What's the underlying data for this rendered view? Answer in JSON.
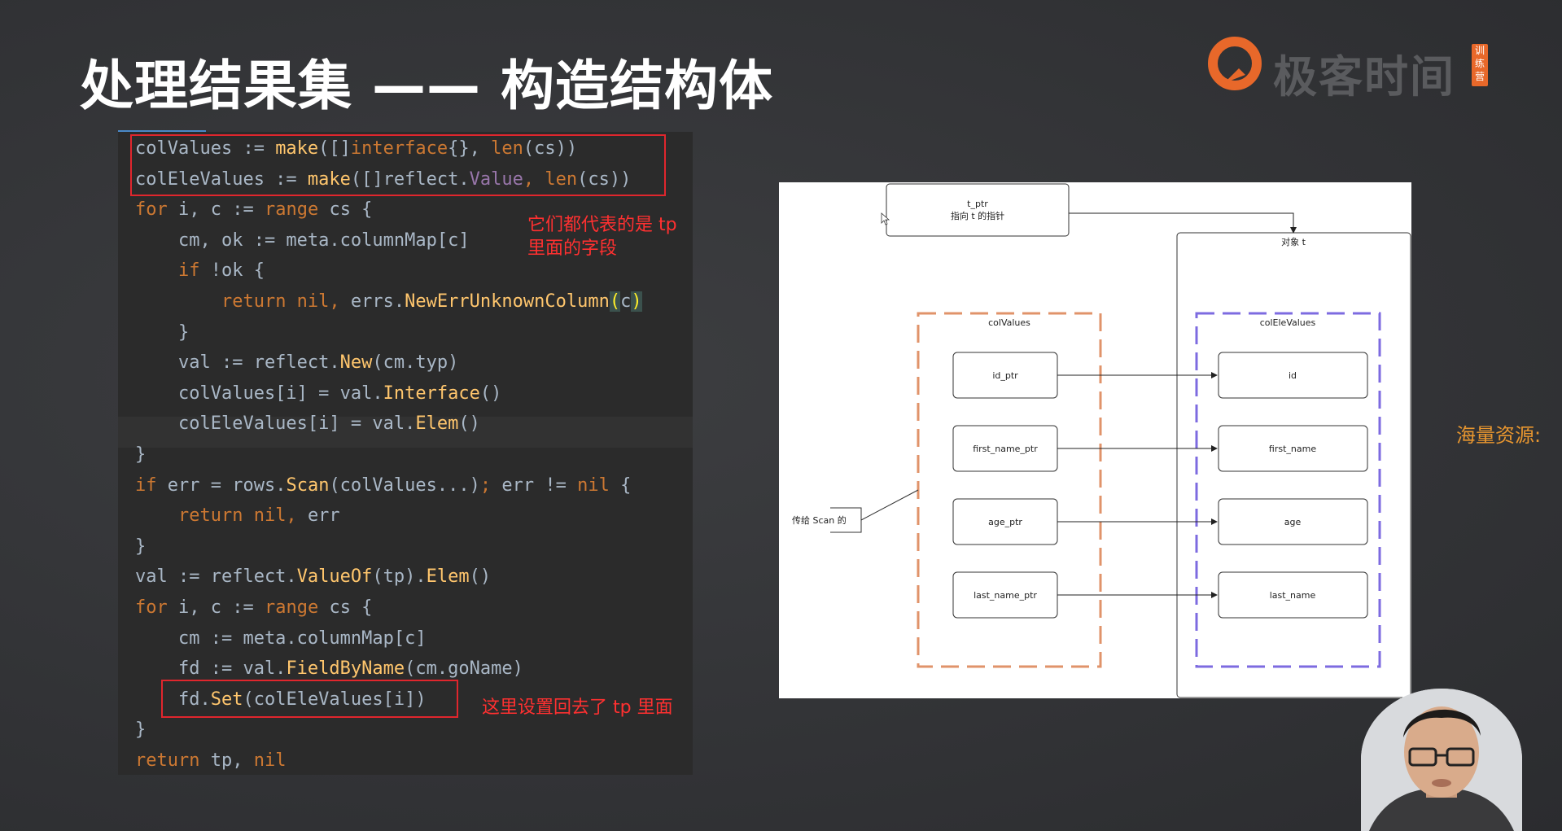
{
  "slide": {
    "title": "处理结果集 —— 构造结构体"
  },
  "logo": {
    "text": "极客时间",
    "badge": "训练营"
  },
  "code": {
    "lines": [
      [
        {
          "t": "colValues := ",
          "c": "pl"
        },
        {
          "t": "make",
          "c": "fn"
        },
        {
          "t": "([]",
          "c": "pl"
        },
        {
          "t": "interface",
          "c": "kw"
        },
        {
          "t": "{}, ",
          "c": "pl"
        },
        {
          "t": "len",
          "c": "kw"
        },
        {
          "t": "(cs))",
          "c": "pl"
        }
      ],
      [
        {
          "t": "colEleValues := ",
          "c": "pl"
        },
        {
          "t": "make",
          "c": "fn"
        },
        {
          "t": "([]reflect.",
          "c": "pl"
        },
        {
          "t": "Value",
          "c": "vl"
        },
        {
          "t": ", ",
          "c": "kw"
        },
        {
          "t": "len",
          "c": "kw"
        },
        {
          "t": "(cs))",
          "c": "pl"
        }
      ],
      [
        {
          "t": "for",
          "c": "kw"
        },
        {
          "t": " i, c := ",
          "c": "pl"
        },
        {
          "t": "range",
          "c": "kw"
        },
        {
          "t": " cs {",
          "c": "pl"
        }
      ],
      [
        {
          "t": "    cm, ok := meta.columnMap[c]",
          "c": "pl"
        }
      ],
      [
        {
          "t": "    ",
          "c": "pl"
        },
        {
          "t": "if",
          "c": "kw"
        },
        {
          "t": " !ok {",
          "c": "pl"
        }
      ],
      [
        {
          "t": "        ",
          "c": "pl"
        },
        {
          "t": "return nil, ",
          "c": "kw"
        },
        {
          "t": "errs.",
          "c": "pl"
        },
        {
          "t": "NewErrUnknownColumn",
          "c": "fn"
        },
        {
          "t": "(",
          "c": "br"
        },
        {
          "t": "c",
          "c": "pl"
        },
        {
          "t": ")",
          "c": "br"
        }
      ],
      [
        {
          "t": "    }",
          "c": "pl"
        }
      ],
      [
        {
          "t": "    val := reflect.",
          "c": "pl"
        },
        {
          "t": "New",
          "c": "fn"
        },
        {
          "t": "(cm.typ)",
          "c": "pl"
        }
      ],
      [
        {
          "t": "    colValues[i] = val.",
          "c": "pl"
        },
        {
          "t": "Interface",
          "c": "fn"
        },
        {
          "t": "()",
          "c": "pl"
        }
      ],
      [
        {
          "t": "    colEleValues[i] = val.",
          "c": "pl"
        },
        {
          "t": "Elem",
          "c": "fn"
        },
        {
          "t": "()",
          "c": "pl"
        }
      ],
      [
        {
          "t": "}",
          "c": "pl"
        }
      ],
      [
        {
          "t": "if",
          "c": "kw"
        },
        {
          "t": " err = rows.",
          "c": "pl"
        },
        {
          "t": "Scan",
          "c": "fn"
        },
        {
          "t": "(colValues...)",
          "c": "pl"
        },
        {
          "t": ";",
          "c": "kw"
        },
        {
          "t": " err != ",
          "c": "pl"
        },
        {
          "t": "nil",
          "c": "kw"
        },
        {
          "t": " {",
          "c": "pl"
        }
      ],
      [
        {
          "t": "    ",
          "c": "pl"
        },
        {
          "t": "return nil, ",
          "c": "kw"
        },
        {
          "t": "err",
          "c": "pl"
        }
      ],
      [
        {
          "t": "}",
          "c": "pl"
        }
      ],
      [
        {
          "t": "val := reflect.",
          "c": "pl"
        },
        {
          "t": "ValueOf",
          "c": "fn"
        },
        {
          "t": "(tp).",
          "c": "pl"
        },
        {
          "t": "Elem",
          "c": "fn"
        },
        {
          "t": "()",
          "c": "pl"
        }
      ],
      [
        {
          "t": "for",
          "c": "kw"
        },
        {
          "t": " i, c := ",
          "c": "pl"
        },
        {
          "t": "range",
          "c": "kw"
        },
        {
          "t": " cs {",
          "c": "pl"
        }
      ],
      [
        {
          "t": "    cm := meta.columnMap[c]",
          "c": "pl"
        }
      ],
      [
        {
          "t": "    fd := val.",
          "c": "pl"
        },
        {
          "t": "FieldByName",
          "c": "fn"
        },
        {
          "t": "(cm.goName)",
          "c": "pl"
        }
      ],
      [
        {
          "t": "    fd.",
          "c": "pl"
        },
        {
          "t": "Set",
          "c": "fn"
        },
        {
          "t": "(colEleValues[i])",
          "c": "pl"
        }
      ],
      [
        {
          "t": "}",
          "c": "pl"
        }
      ],
      [
        {
          "t": "return",
          "c": "kw"
        },
        {
          "t": " tp, ",
          "c": "pl"
        },
        {
          "t": "nil",
          "c": "kw"
        }
      ]
    ]
  },
  "annotations": {
    "note1_line1": "它们都代表的是 tp",
    "note1_line2": "里面的字段",
    "note2": "这里设置回去了 tp 里面"
  },
  "diagram": {
    "t_ptr": "t_ptr",
    "t_ptr_desc": "指向 t 的指针",
    "object_t": "对象 t",
    "col_values_label": "colValues",
    "col_ele_values_label": "colEleValues",
    "left_boxes": [
      "id_ptr",
      "first_name_ptr",
      "age_ptr",
      "last_name_ptr"
    ],
    "right_boxes": [
      "id",
      "first_name",
      "age",
      "last_name"
    ],
    "scan_label": "传给 Scan 的"
  },
  "side_note": "海量资源:",
  "colors": {
    "background": "#333437",
    "code_bg": "#2b2b2b",
    "keyword": "#cc7832",
    "function": "#ffc66d",
    "red_annotation": "#ff3030",
    "col_values_dash": "#e0936a",
    "col_ele_values_dash": "#7d6be0",
    "side_note": "#e8962f",
    "logo_orange": "#e8682a"
  }
}
